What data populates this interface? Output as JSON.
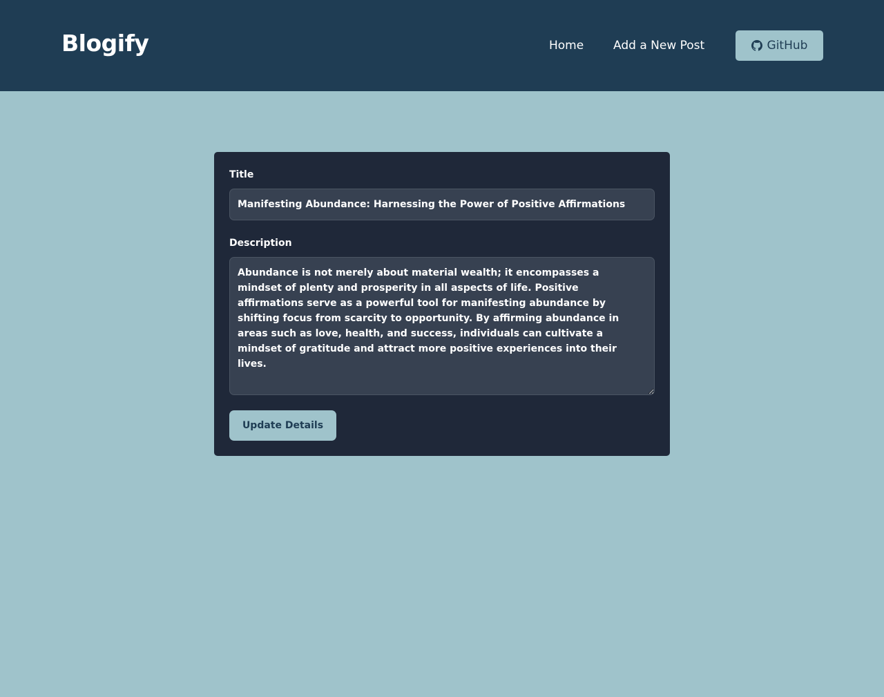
{
  "header": {
    "brand": "Blogify",
    "nav": {
      "home": "Home",
      "add_post": "Add a New Post"
    },
    "github": {
      "label": "GitHub",
      "icon": "github-icon"
    }
  },
  "form": {
    "title_label": "Title",
    "title_value": "Manifesting Abundance: Harnessing the Power of Positive Affirmations",
    "description_label": "Description",
    "description_value": "Abundance is not merely about material wealth; it encompasses a mindset of plenty and prosperity in all aspects of life. Positive affirmations serve as a powerful tool for manifesting abundance by shifting focus from scarcity to opportunity. By affirming abundance in areas such as love, health, and success, individuals can cultivate a mindset of gratitude and attract more positive experiences into their lives.",
    "submit_label": "Update Details"
  },
  "colors": {
    "header_bg": "#1f3d54",
    "page_bg": "#9fc3cb",
    "card_bg": "#1f2839",
    "input_bg": "#374151",
    "accent": "#9fc3cb"
  }
}
